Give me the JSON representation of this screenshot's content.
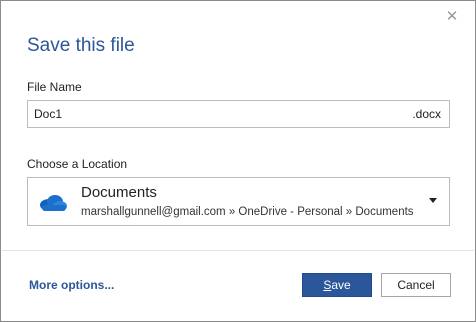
{
  "dialog": {
    "title": "Save this file",
    "close_icon": "close-icon"
  },
  "file_name": {
    "label": "File Name",
    "value": "Doc1",
    "extension": ".docx"
  },
  "location": {
    "label": "Choose a Location",
    "icon": "onedrive-cloud-icon",
    "name": "Documents",
    "path": "marshallgunnell@gmail.com » OneDrive - Personal » Documents"
  },
  "footer": {
    "more_options": "More options...",
    "save_accel": "S",
    "save_rest": "ave",
    "cancel_label": "Cancel"
  },
  "colors": {
    "accent": "#2b579a",
    "onedrive_blue": "#1d6fc9"
  }
}
